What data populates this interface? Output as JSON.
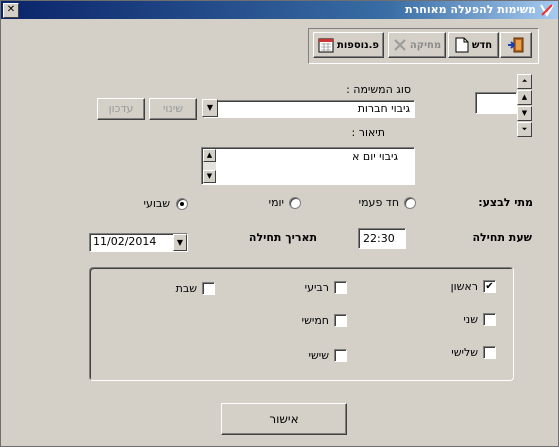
{
  "window": {
    "title": "משימות להפעלה מאוחרת",
    "close_glyph": "✕"
  },
  "toolbar": {
    "exit_icon": "exit-door-icon",
    "new_label": "חדש",
    "delete_label": "מחיקה",
    "extras_label": "פ.נוספות"
  },
  "task_type": {
    "label": "סוג המשימה :",
    "value": "גיבוי חברות"
  },
  "description": {
    "label": "תיאור :",
    "value": "גיבוי יום א"
  },
  "buttons": {
    "change": "שינוי",
    "update": "עדכון",
    "ok": "אישור"
  },
  "when": {
    "label": "מתי לבצע:",
    "options": [
      "חד פעמי",
      "יומי",
      "שבועי"
    ],
    "selected": "שבועי"
  },
  "start_time": {
    "label": "שעת תחילה",
    "value": "22:30"
  },
  "start_date": {
    "label": "תאריך תחילה",
    "value": "11/02/2014"
  },
  "days": [
    {
      "label": "ראשון",
      "checked": true
    },
    {
      "label": "שני",
      "checked": false
    },
    {
      "label": "שלישי",
      "checked": false
    },
    {
      "label": "רביעי",
      "checked": false
    },
    {
      "label": "חמישי",
      "checked": false
    },
    {
      "label": "שישי",
      "checked": false
    },
    {
      "label": "שבת",
      "checked": false
    }
  ],
  "colors": {
    "titlebar_start": "#0a246a",
    "titlebar_end": "#a6caf0",
    "face": "#d4d0c8"
  }
}
